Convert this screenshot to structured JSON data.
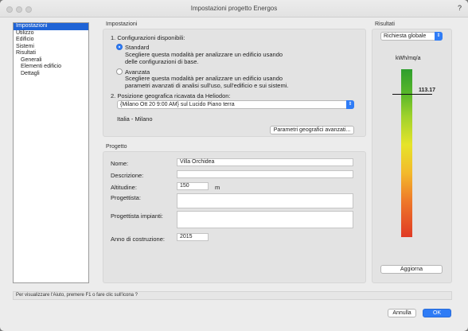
{
  "window": {
    "title": "Impostazioni progetto Energos",
    "help": "?"
  },
  "sidebar": {
    "items": [
      {
        "label": "Impostazioni"
      },
      {
        "label": "Utilizzo"
      },
      {
        "label": "Edificio"
      },
      {
        "label": "Sistemi"
      },
      {
        "label": "Risultati"
      },
      {
        "label": "Generali"
      },
      {
        "label": "Elementi edificio"
      },
      {
        "label": "Dettagli"
      }
    ]
  },
  "impostazioni": {
    "section_label": "Impostazioni",
    "config_label": "1. Configurazioni disponibili:",
    "standard_label": "Standard",
    "standard_desc_1": "Scegliere questa modalità per analizzare un edificio usando",
    "standard_desc_2": "delle configurazioni di base.",
    "avanzata_label": "Avanzata",
    "avanzata_desc_1": "Scegliere questa modalità per analizzare un edificio usando",
    "avanzata_desc_2": "parametri avanzati di analisi sull'uso, sull'edificio e sui sistemi.",
    "position_label": "2. Posizione geografica ricavata da Heliodon:",
    "position_value": "{Milano Ott 20 9:00 AM} sul Lucido Piano terra",
    "location": "Italia - Milano",
    "geo_button": "Parametri geografici avanzati..."
  },
  "progetto": {
    "section_label": "Progetto",
    "nome_label": "Nome:",
    "nome_value": "Villa Orchidea",
    "descrizione_label": "Descrizione:",
    "descrizione_value": "",
    "altitudine_label": "Altitudine:",
    "altitudine_value": "150",
    "altitudine_unit": "m",
    "progettista_label": "Progettista:",
    "progettista_impianti_label": "Progettista impianti:",
    "anno_label": "Anno di costruzione:",
    "anno_value": "2015"
  },
  "risultati": {
    "section_label": "Risultati",
    "select_value": "Richiesta globale",
    "unit": "kWh/mq/a",
    "value": "113.17",
    "update_button": "Aggiorna"
  },
  "status_text": "Per visualizzare l'Aiuto, premere F1 o fare clic sull'icona ?",
  "footer": {
    "cancel_label": "Annulla",
    "ok_label": "OK"
  }
}
